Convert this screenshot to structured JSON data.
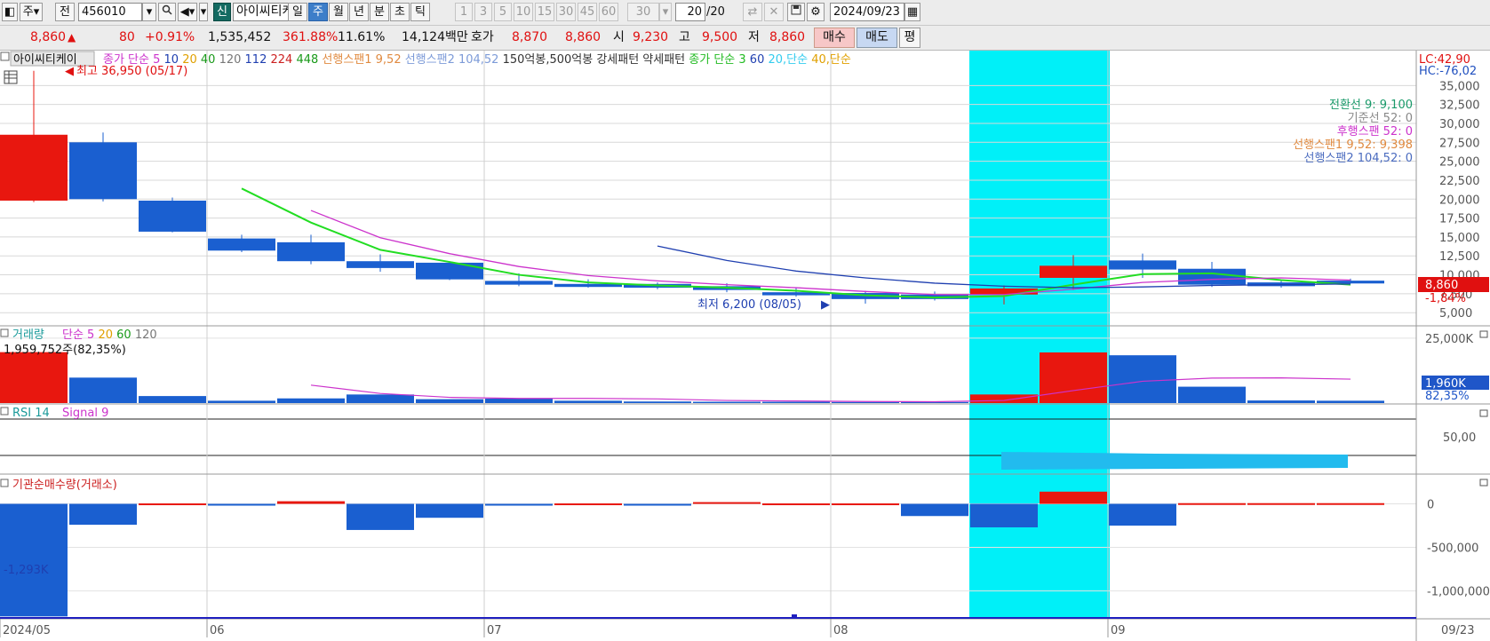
{
  "toolbar": {
    "period_short": "주",
    "prev_label": "전",
    "stock_code": "456010",
    "new_badge": "신",
    "stock_name": "아이씨티케",
    "timeframes": [
      {
        "label": "일",
        "active": false
      },
      {
        "label": "주",
        "active": true
      },
      {
        "label": "월",
        "active": false
      },
      {
        "label": "년",
        "active": false
      },
      {
        "label": "분",
        "active": false
      },
      {
        "label": "초",
        "active": false
      },
      {
        "label": "틱",
        "active": false
      }
    ],
    "minute_options": [
      "1",
      "3",
      "5",
      "10",
      "15",
      "30",
      "45",
      "60"
    ],
    "minute_select": "30",
    "count_value": "20",
    "count_total": "/20",
    "date": "2024/09/23"
  },
  "quote": {
    "price": "8,860",
    "change_arrow": "▲",
    "change": "80",
    "change_pct": "+0.91%",
    "volume": "1,535,452",
    "volume_ratio": "361.88%",
    "turnover": "11.61%",
    "amount": "14,124백만",
    "hoga_label": "호가",
    "ask": "8,870",
    "bid": "8,860",
    "open_label": "시",
    "open": "9,230",
    "high_label": "고",
    "high": "9,500",
    "low_label": "저",
    "low": "8,860",
    "buy_label": "매수",
    "sell_label": "매도",
    "eval_label": "평"
  },
  "price_pane": {
    "title": "아이씨티케이",
    "legend": [
      {
        "text": "종가 단순 5",
        "color": "#cc33cc"
      },
      {
        "text": "10",
        "color": "#1f3fb0"
      },
      {
        "text": "20",
        "color": "#e0a000"
      },
      {
        "text": "40",
        "color": "#1a9a1a"
      },
      {
        "text": "120",
        "color": "#777777"
      },
      {
        "text": "112",
        "color": "#1f3fb0"
      },
      {
        "text": "224",
        "color": "#cc2020"
      },
      {
        "text": "448",
        "color": "#1a9a1a"
      },
      {
        "text": "선행스팬1 9,52",
        "color": "#e08a40"
      },
      {
        "text": "선행스팬2 104,52",
        "color": "#7d9bd8"
      },
      {
        "text": "150억봉,500억봉 강세패턴",
        "color": "#333333"
      },
      {
        "text": "약세패턴",
        "color": "#333333"
      },
      {
        "text": "종가 단순 3",
        "color": "#22bb22"
      },
      {
        "text": "60",
        "color": "#1f3fb0"
      },
      {
        "text": "20,단순",
        "color": "#33ccee"
      },
      {
        "text": "40,단순",
        "color": "#e0a000"
      }
    ],
    "high_annotation": "최고 36,950 (05/17)",
    "low_annotation": "최저 6,200 (08/05)",
    "lc_label": "LC:42,90",
    "hc_label": "HC:-76,02",
    "current_price_tag": "8,860",
    "current_pct_tag": "-1,84%",
    "ichimoku": [
      {
        "text": "전환선 9: 9,100",
        "color": "#1a9a6a"
      },
      {
        "text": "기준선 52: 0",
        "color": "#888888"
      },
      {
        "text": "후행스팬 52: 0",
        "color": "#cc33cc"
      },
      {
        "text": "선행스팬1 9,52: 9,398",
        "color": "#e08a40"
      },
      {
        "text": "선행스팬2 104,52: 0",
        "color": "#4a6bbf"
      }
    ],
    "y_ticks": [
      "35,000",
      "32,500",
      "30,000",
      "27,500",
      "25,000",
      "22,500",
      "20,000",
      "17,500",
      "15,000",
      "12,500",
      "10,000",
      "7,500",
      "5,000"
    ]
  },
  "volume_pane": {
    "title": "거래량",
    "legend": [
      {
        "text": "단순 5",
        "color": "#cc33cc"
      },
      {
        "text": "20",
        "color": "#e0a000"
      },
      {
        "text": "60",
        "color": "#1a9a1a"
      },
      {
        "text": "120",
        "color": "#777777"
      }
    ],
    "info": "1,959,752주(82,35%)",
    "y_ticks": [
      "25,000K"
    ],
    "current_tag": "1,960K",
    "current_pct": "82,35%"
  },
  "rsi_pane": {
    "title": "RSI 14",
    "signal": "Signal 9",
    "y_ticks": [
      "50,00"
    ]
  },
  "inst_pane": {
    "title": "기관순매수량(거래소)",
    "value_label": "-1,293K",
    "y_ticks": [
      "0",
      "-500,000",
      "-1,000,000"
    ]
  },
  "x_axis": {
    "labels": [
      "2024/05",
      "06",
      "07",
      "08",
      "09"
    ],
    "end_label": "09/23"
  },
  "chart_data": {
    "type": "candlestick",
    "x": [
      "05/13",
      "05/20",
      "05/27",
      "06/03",
      "06/10",
      "06/17",
      "06/24",
      "07/01",
      "07/08",
      "07/15",
      "07/22",
      "07/29",
      "08/05",
      "08/12",
      "08/19",
      "08/26",
      "09/02",
      "09/09",
      "09/16",
      "09/23"
    ],
    "price": {
      "open": [
        19800,
        27500,
        19800,
        14800,
        14300,
        11800,
        11600,
        9200,
        8800,
        8800,
        8500,
        7700,
        7600,
        7400,
        7400,
        9600,
        11900,
        10800,
        9000,
        9230
      ],
      "close": [
        28500,
        20000,
        15700,
        13200,
        11800,
        10900,
        9400,
        8700,
        8400,
        8300,
        8000,
        7300,
        6800,
        6800,
        8200,
        11200,
        10700,
        8700,
        8500,
        8860
      ],
      "high": [
        36950,
        28800,
        20200,
        15300,
        15300,
        12700,
        11800,
        10200,
        9400,
        9000,
        8900,
        8300,
        7900,
        7800,
        8600,
        12600,
        12800,
        11700,
        9200,
        9500
      ],
      "low": [
        19600,
        19700,
        15600,
        13000,
        11400,
        10400,
        9300,
        8500,
        8300,
        8100,
        7700,
        7100,
        6200,
        6600,
        6100,
        8000,
        9600,
        8400,
        8300,
        8860
      ],
      "ma3": [
        null,
        null,
        null,
        21400,
        16900,
        13300,
        11700,
        10000,
        9000,
        8600,
        8300,
        7900,
        7300,
        7000,
        7200,
        8700,
        10100,
        10200,
        9300,
        8700
      ],
      "ma5": [
        null,
        null,
        null,
        null,
        18500,
        14900,
        12800,
        11100,
        9900,
        9200,
        8700,
        8300,
        7800,
        7400,
        7400,
        8100,
        9000,
        9400,
        9600,
        9300
      ],
      "ma10": [
        null,
        null,
        null,
        null,
        null,
        null,
        null,
        null,
        null,
        13800,
        11900,
        10500,
        9600,
        8900,
        8500,
        8300,
        8400,
        8600,
        8700,
        8800
      ]
    },
    "volume": {
      "values": [
        19600,
        9800,
        2700,
        900,
        1800,
        3300,
        1500,
        1700,
        900,
        600,
        500,
        500,
        400,
        400,
        3300,
        19500,
        18400,
        6300,
        1000,
        900
      ],
      "ma5": [
        null,
        null,
        null,
        null,
        6900,
        3700,
        2200,
        1800,
        1800,
        1600,
        1000,
        800,
        600,
        500,
        1000,
        4800,
        8400,
        9600,
        9700,
        9200
      ]
    },
    "inst_net": [
      -1293000,
      -240000,
      5000,
      -20000,
      30000,
      -300000,
      -160000,
      -20000,
      5000,
      -20000,
      20000,
      5000,
      5000,
      -140000,
      -270000,
      140000,
      -250000,
      8000,
      8000,
      8000
    ],
    "highlight_weeks": [
      "08/19",
      "08/26"
    ],
    "ylim_price": [
      3500,
      37500
    ],
    "ylim_volume": [
      0,
      27000
    ],
    "ylim_inst": [
      -1300000,
      250000
    ]
  }
}
